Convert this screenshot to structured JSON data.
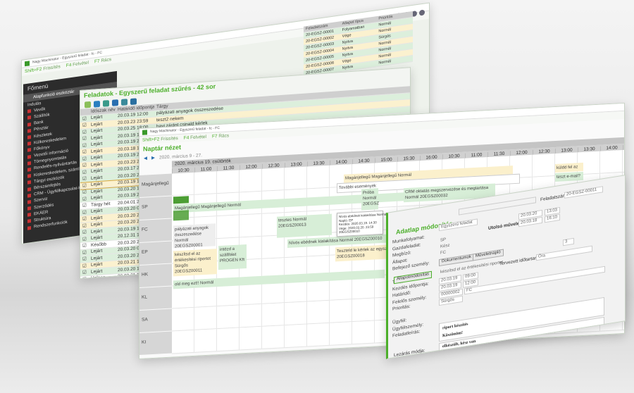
{
  "app_title": "Nagy Machinator - Egyszerű feladat - fc - FC",
  "keys": {
    "refresh": "Shift+F2",
    "refresh_label": "Frissítés",
    "add": "F4",
    "add_label": "Felvétel",
    "grid": "F7",
    "grid_label": "Rács"
  },
  "menu": {
    "title": "Főmenü",
    "selected": "Alapfunkció eszköztár",
    "start": "Indulás",
    "items": [
      "Vevők",
      "Szállítók",
      "Bank",
      "Pénztár",
      "Készletek",
      "Külkereskedelem",
      "Főkönyv",
      "Vezetői információ",
      "Tömegnyomtatás",
      "Rendelés-nyilvántartás",
      "Kiskereskedelem, számlázás",
      "Tárgyi eszközök",
      "Bérszámfejtés",
      "CRM - Ügyfélkapcsolat-kezelés",
      "Szerviz",
      "Szerződés",
      "EKÁER",
      "Struktúra",
      "Rendszerfunkciók"
    ]
  },
  "back_grid": {
    "headers": [
      "Feladatszám",
      "Állapot típus",
      "Prioritás"
    ],
    "rows": [
      [
        "20-EGSZ-00001",
        "Folyamatban",
        "Normál"
      ],
      [
        "20-EGSZ-00002",
        "Vége",
        "Normál"
      ],
      [
        "20-EGSZ-00003",
        "Nyitva",
        "Sürgős"
      ],
      [
        "20-EGSZ-00004",
        "Nyitva",
        "Normál"
      ],
      [
        "20-EGSZ-00005",
        "Nyitva",
        "Normál"
      ],
      [
        "20-EGSZ-00006",
        "Vége",
        "Normál"
      ],
      [
        "20-EGSZ-00007",
        "Nyitva",
        "Normál"
      ]
    ]
  },
  "tasks": {
    "title": "Feladatok - Egyszerű feladat szűrés - 42 sor",
    "headers": [
      "Időszak név",
      "Határidő időpontja",
      "Tárgy"
    ],
    "rows": [
      [
        "Lejárt",
        "20.03.19 12:00",
        "pályázati anyagok összeszedése"
      ],
      [
        "Lejárt",
        "20.03.23 23:59",
        "teszt2 nekem"
      ],
      [
        "Lejárt",
        "20.03.25 18:00",
        "havi zárást csinald kérlek"
      ],
      [
        "Lejárt",
        "20.03.19 13:00",
        "intézd a szállítást"
      ],
      [
        "Lejárt",
        "20.03.19 23:59",
        "old meg ezt!"
      ],
      [
        "Lejárt",
        "20.03.18 10:00",
        "oldd meg mielőbb!!!"
      ],
      [
        "Lejárt",
        "20.03.19 23:59",
        ""
      ],
      [
        "Lejárt",
        "20.03.23 23:59",
        ""
      ],
      [
        "Lejárt",
        "20.03.17 23:59",
        ""
      ],
      [
        "Lejárt",
        "20.03.20 23:59",
        ""
      ],
      [
        "Lejárt",
        "20.03.19 12:00",
        ""
      ],
      [
        "Lejárt",
        "20.03.20 15:00",
        ""
      ],
      [
        "Lejárt",
        "20.03.19 23:59",
        ""
      ],
      [
        "Tárgy hét",
        "20.04.01 20:03",
        ""
      ],
      [
        "Lejárt",
        "20.03.20 06:30",
        ""
      ],
      [
        "Lejárt",
        "20.03.20 23:59",
        ""
      ],
      [
        "Lejárt",
        "20.03.20 23:59",
        ""
      ],
      [
        "Lejárt",
        "20.03.19 17:00",
        ""
      ],
      [
        "Lejárt",
        "20.12.31 12:01",
        ""
      ],
      [
        "Később",
        "20.03.20 23:59",
        ""
      ],
      [
        "Lejárt",
        "20.03.20 09:30",
        ""
      ],
      [
        "Lejárt",
        "20.03.20 23:59",
        ""
      ],
      [
        "Lejárt",
        "20.03.21 12:02",
        ""
      ],
      [
        "Lejárt",
        "20.03.20 13:10",
        ""
      ],
      [
        "Holnap",
        "20.02.21 12:43",
        ""
      ]
    ]
  },
  "calendar": {
    "title": "Naptár nézet",
    "range": "2020. március 9 - 27.",
    "day": "2020. március 19. csütörtök",
    "times": [
      "10:30",
      "11:00",
      "11:30",
      "12:00",
      "12:30",
      "13:00",
      "13:30",
      "14:00",
      "14:30",
      "15:00",
      "15:30",
      "16:00",
      "10:30",
      "11:00",
      "11:30",
      "12:00",
      "12:30",
      "13:00",
      "13:30",
      "14:00",
      "14:30"
    ],
    "lanes": [
      "Magánjellegű",
      "SP",
      "FC",
      "EP",
      "HK",
      "KL",
      "SA",
      "KI"
    ],
    "events": {
      "e1": "Magánjellegű Magánjellegű Normál",
      "e2": "pályázati anyagok összeszedése  Normál 20EGSZ00001",
      "e3": "tesztes  Normál 20EGSZ00013",
      "e4": "készítsd el az értékesítési riportot  Sürgős 20EGSZ00011",
      "e5": "intézd a szállítást PROGEN Kft",
      "e6": "Nívós ebédnek kialakítása  Normál 20EGSZ00010",
      "e7": "Teszteld le kérlek az egyszerű feladatot  CRM modulban CSÖCSÖN PROGEN Kft Normál 20EGSZ00018",
      "e8": "old meg ezt!!  Normál",
      "e9": "Magánjellegű Magánjellegű Normál",
      "e10": "További események",
      "e11": "CRM oktatás megszervezése és megtartása  Normál 20EGSZ00032",
      "e12": "teszt e-mail?",
      "e13": "küldd fel az",
      "e14": "Próba Normál 20EGSZ"
    },
    "tooltip": {
      "title": "Nívós ebédnek kialakítása  Normál",
      "rows": [
        "Napló: EP",
        "Kezdés: 2020.03.19. 14:30",
        "Vége: 2020.03.20. 23:59"
      ],
      "code": "20EGSZ00010"
    }
  },
  "form": {
    "title": "Adatlap módosítás",
    "task_no_label": "Feladatszám:",
    "task_no": "20-EGSZ-00011",
    "labels": [
      "Munkafolyamat:",
      "Gazdafeladat:",
      "Megbízó:",
      "Állapot:",
      "Befejező személy:",
      "",
      "Tárgy:",
      "Kezdés időpontja:",
      "Határidő:",
      "Felelős személy:",
      "Prioritás:",
      "",
      "Ügyfél:",
      "Ügyfélszemély:",
      "Feladatleírás:"
    ],
    "type": "Egyszerű feladat",
    "client": "SP",
    "state": "Kész",
    "finisher": "FC",
    "last_op_label": "Utolsó művelet:",
    "d1": "20.03.20",
    "t1": "13:03",
    "d2": "20.03.18",
    "t2": "16:10",
    "docs_btn": "Dokumentumok",
    "ops_btn": "Műveletnapló",
    "num": "3",
    "state_btn": "Állapotmódosítás",
    "subject": "készítsd el az értékesítési riportot",
    "duration_label": "Tervezett időtartam:",
    "duration": "Óra",
    "start_d": "20.03.19",
    "start_t": "09:00",
    "end_d": "20.03.19",
    "end_t": "12:00",
    "person": "00000002",
    "person_name": "FC",
    "priority": "Sürgős",
    "desc1": "riport készítés",
    "desc2": "Köszönöm!",
    "close_label": "Lezárás módja:",
    "close": "elkészült, kész van"
  }
}
